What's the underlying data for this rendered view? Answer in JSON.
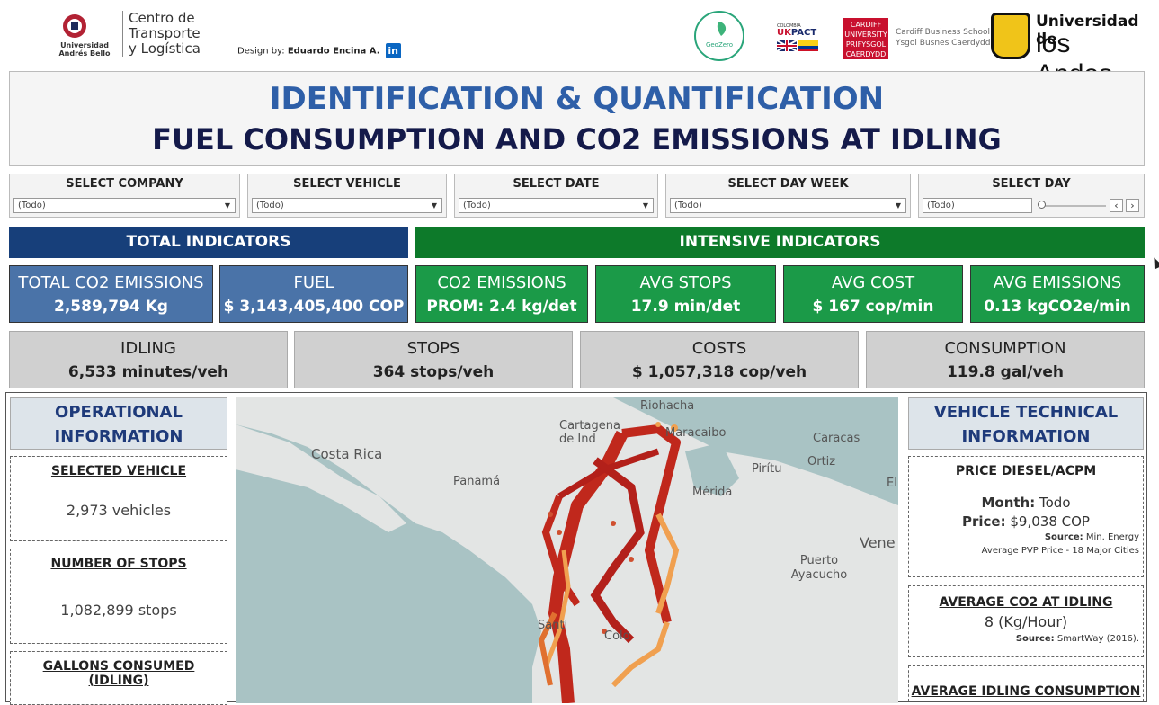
{
  "header": {
    "uab_name": "Universidad Andrés Bello",
    "ctl_name": "Centro de Transporte y Logística",
    "design_prefix": "Design by:",
    "designer": "Eduardo Encina A.",
    "linkedin_icon": "in",
    "geozero": "GeoZero",
    "ukpact": {
      "uk": "UK",
      "pact": "PACT",
      "country": "COLOMBIA"
    },
    "cardiff": "CARDIFF UNIVERSITY PRIFYSGOL CAERDYDD",
    "cbs": [
      "Cardiff Business School",
      "Ysgol Busnes Caerdydd"
    ],
    "uandes": {
      "line1": "Universidad de",
      "line2": "los Andes"
    }
  },
  "title": {
    "line1": "IDENTIFICATION & QUANTIFICATION",
    "line2": "FUEL CONSUMPTION AND CO2 EMISSIONS AT IDLING"
  },
  "filters": [
    {
      "label": "SELECT COMPANY",
      "value": "(Todo)"
    },
    {
      "label": "SELECT VEHICLE",
      "value": "(Todo)"
    },
    {
      "label": "SELECT DATE",
      "value": "(Todo)"
    },
    {
      "label": "SELECT DAY WEEK",
      "value": "(Todo)"
    },
    {
      "label": "SELECT DAY",
      "value": "(Todo)"
    }
  ],
  "sections": {
    "total": "TOTAL INDICATORS",
    "intensive": "INTENSIVE INDICATORS"
  },
  "kpis": [
    {
      "label": "TOTAL CO2 EMISSIONS",
      "value": "2,589,794 Kg"
    },
    {
      "label": "FUEL",
      "value": "$ 3,143,405,400 COP"
    },
    {
      "label": "CO2 EMISSIONS",
      "value": "PROM: 2.4 kg/det"
    },
    {
      "label": "AVG STOPS",
      "value": "17.9 min/det"
    },
    {
      "label": "AVG COST",
      "value": "$ 167 cop/min"
    },
    {
      "label": "AVG EMISSIONS",
      "value": "0.13 kgCO2e/min"
    }
  ],
  "gray_kpis": [
    {
      "label": "IDLING",
      "value": "6,533 minutes/veh"
    },
    {
      "label": "STOPS",
      "value": "364 stops/veh"
    },
    {
      "label": "COSTS",
      "value": "$ 1,057,318 cop/veh"
    },
    {
      "label": "CONSUMPTION",
      "value": "119.8 gal/veh"
    }
  ],
  "operational": {
    "title": "OPERATIONAL INFORMATION",
    "cards": [
      {
        "heading": "SELECTED VEHICLE",
        "value": "2,973 vehicles"
      },
      {
        "heading": "NUMBER OF STOPS",
        "value": "1,082,899 stops"
      },
      {
        "heading": "GALLONS CONSUMED (IDLING)",
        "value": ""
      }
    ]
  },
  "technical": {
    "title": "VEHICLE TECHNICAL INFORMATION",
    "price_card": {
      "heading": "PRICE DIESEL/ACPM",
      "month_label": "Month:",
      "month_value": "Todo",
      "price_label": "Price:",
      "price_value": "$9,038 COP",
      "source_label": "Source:",
      "source_value": "Min. Energy",
      "note": "Average PVP Price - 18 Major Cities"
    },
    "co2_card": {
      "heading": "AVERAGE CO2 AT IDLING",
      "value": "8 (Kg/Hour)",
      "source_label": "Source:",
      "source_value": "SmartWay (2016)."
    },
    "consumption_card": {
      "heading": "AVERAGE IDLING CONSUMPTION"
    }
  },
  "map": {
    "labels": [
      "Riohacha",
      "Cartagena de Ind",
      "Maracaibo",
      "Caracas",
      "Costa Rica",
      "Panamá",
      "Pirítu",
      "Ortiz",
      "El",
      "Mérida",
      "Vene",
      "Puerto Ayacucho",
      "Santi",
      "Colo"
    ]
  },
  "colors": {
    "title_blue": "#2e5fa8",
    "title_navy": "#141a4a",
    "total_header": "#173f7a",
    "intensive_header": "#0d7a2a",
    "kpi_blue": "#4a73a8",
    "kpi_green": "#1b9a48",
    "route_red": "#c0281c",
    "route_orange": "#f0a050"
  }
}
